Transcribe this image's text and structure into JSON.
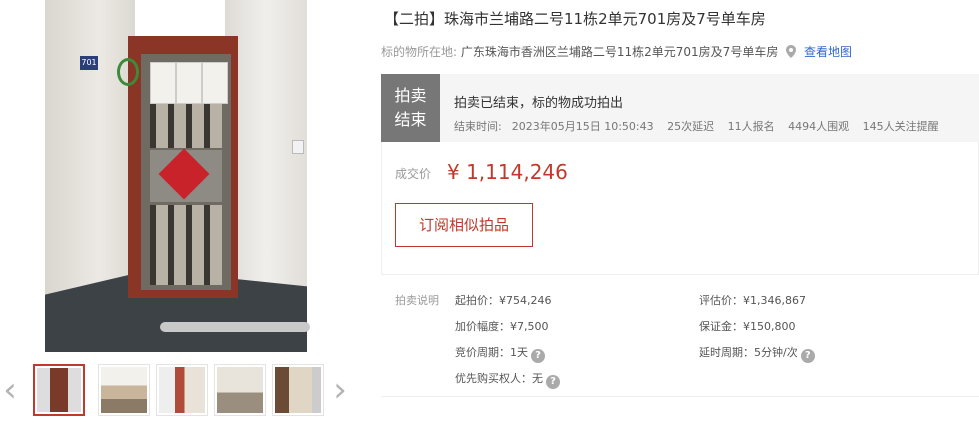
{
  "listing": {
    "title": "【二拍】珠海市兰埔路二号11栋2单元701房及7号单车房",
    "location_label": "标的物所在地:",
    "location_value": "广东珠海市香洲区兰埔路二号11栋2单元701房及7号单车房",
    "map_link": "查看地图",
    "door_plate": "701"
  },
  "status": {
    "badge_line1": "拍卖",
    "badge_line2": "结束",
    "message": "拍卖已结束，标的物成功拍出",
    "end_time_label": "结束时间:",
    "end_time": "2023年05月15日 10:50:43",
    "delays": "25次延迟",
    "signups": "11人报名",
    "viewers": "4494人围观",
    "followers": "145人关注提醒"
  },
  "price": {
    "label": "成交价",
    "value": "¥ 1,114,246",
    "subscribe_label": "订阅相似拍品"
  },
  "description": {
    "section_label": "拍卖说明",
    "start_price": "起拍价：¥754,246",
    "increment": "加价幅度：¥7,500",
    "cycle": "竞价周期：1天",
    "priority_buyer": "优先购买权人：无",
    "appraisal": "评估价：¥1,346,867",
    "deposit": "保证金：¥150,800",
    "extension": "延时周期：5分钟/次",
    "help_glyph": "?"
  },
  "gallery": {
    "prev_arrow": "‹",
    "next_arrow": "›",
    "thumb_count": 5,
    "active_index": 0
  },
  "icons": {
    "map_pin": "map-pin-icon",
    "help": "help-icon"
  },
  "colors": {
    "accent_red": "#c0392b",
    "badge_gray": "#777777",
    "link_blue": "#3366cc"
  }
}
